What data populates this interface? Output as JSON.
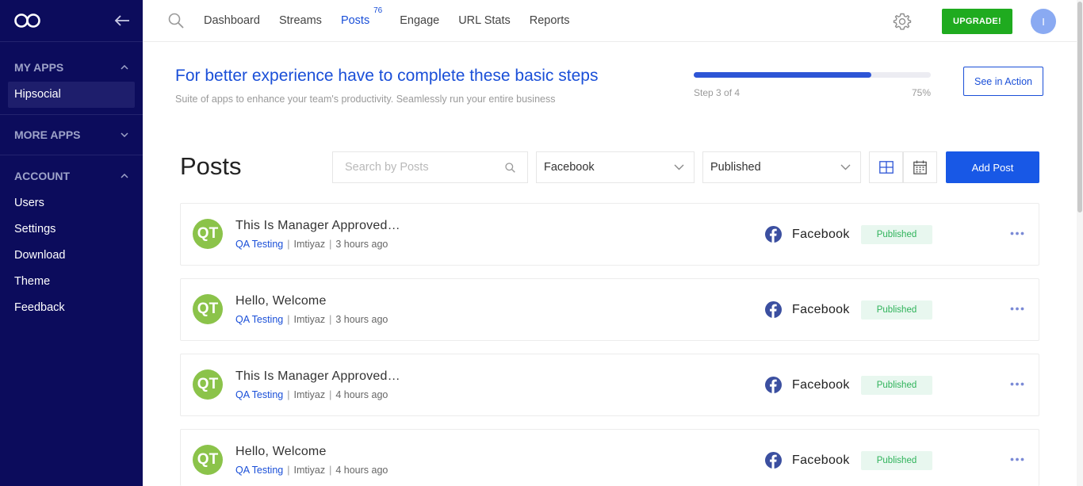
{
  "sidebar": {
    "sections": {
      "my_apps": {
        "label": "MY APPS",
        "items": [
          "Hipsocial"
        ]
      },
      "more_apps": {
        "label": "MORE APPS"
      },
      "account": {
        "label": "ACCOUNT",
        "items": [
          "Users",
          "Settings",
          "Download",
          "Theme",
          "Feedback"
        ]
      }
    }
  },
  "topbar": {
    "nav": [
      {
        "label": "Dashboard"
      },
      {
        "label": "Streams"
      },
      {
        "label": "Posts",
        "badge": "76",
        "active": true
      },
      {
        "label": "Engage"
      },
      {
        "label": "URL Stats"
      },
      {
        "label": "Reports"
      }
    ],
    "upgrade_label": "UPGRADE!",
    "avatar_initial": "I"
  },
  "onboarding": {
    "title": "For better experience have to complete these basic steps",
    "subtitle": "Suite of apps to enhance your team's productivity. Seamlessly run your entire business",
    "step_text": "Step 3 of 4",
    "percent_text": "75%",
    "progress": 0.75,
    "see_action_label": "See in Action"
  },
  "posts": {
    "title": "Posts",
    "search_placeholder": "Search by Posts",
    "platform_filter": "Facebook",
    "status_filter": "Published",
    "add_label": "Add Post",
    "items": [
      {
        "initials": "QT",
        "title": "This Is Manager Approved…",
        "group": "QA Testing",
        "author": "Imtiyaz",
        "time": "3 hours ago",
        "platform": "Facebook",
        "status": "Published"
      },
      {
        "initials": "QT",
        "title": "Hello, Welcome",
        "group": "QA Testing",
        "author": "Imtiyaz",
        "time": "3 hours ago",
        "platform": "Facebook",
        "status": "Published"
      },
      {
        "initials": "QT",
        "title": "This Is Manager Approved…",
        "group": "QA Testing",
        "author": "Imtiyaz",
        "time": "4 hours ago",
        "platform": "Facebook",
        "status": "Published"
      },
      {
        "initials": "QT",
        "title": "Hello, Welcome",
        "group": "QA Testing",
        "author": "Imtiyaz",
        "time": "4 hours ago",
        "platform": "Facebook",
        "status": "Published"
      }
    ]
  },
  "colors": {
    "sidebar_bg": "#0c0c5c",
    "accent": "#1a4fd8",
    "upgrade_green": "#1fab1f",
    "avatar_green": "#8bc34a",
    "status_green": "#2fb35a"
  },
  "icons": [
    "logo-icon",
    "back-arrow-icon",
    "chevron-up-icon",
    "chevron-down-icon",
    "search-icon",
    "gear-icon",
    "grid-view-icon",
    "calendar-icon",
    "facebook-icon",
    "more-dots-icon"
  ]
}
